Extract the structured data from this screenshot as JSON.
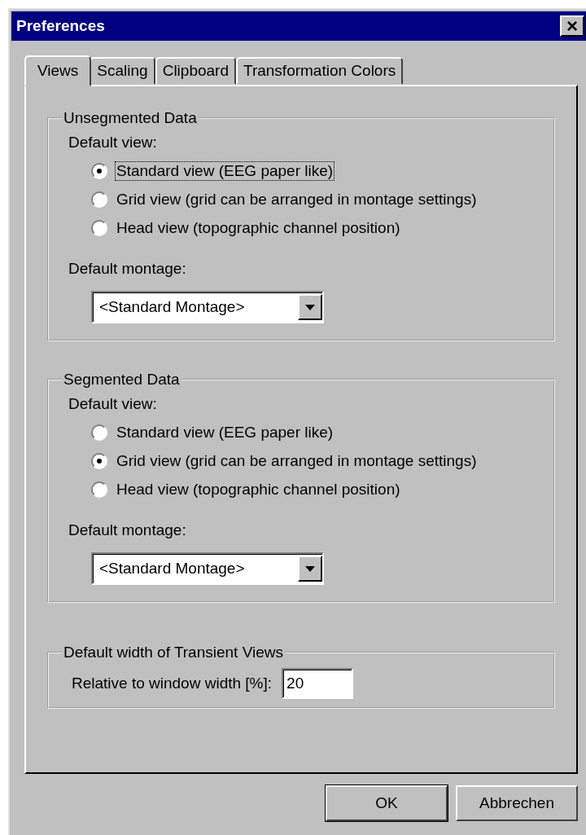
{
  "window": {
    "title": "Preferences",
    "close": "×"
  },
  "tabs": [
    {
      "label": "Views",
      "selected": true
    },
    {
      "label": "Scaling",
      "selected": false
    },
    {
      "label": "Clipboard",
      "selected": false
    },
    {
      "label": "Transformation Colors",
      "selected": false
    }
  ],
  "groups": [
    {
      "kind": "views",
      "title": "Unsegmented Data",
      "view_label": "Default view:",
      "options": [
        {
          "label": "Standard view (EEG paper like)",
          "selected": true,
          "focused": true
        },
        {
          "label": "Grid view (grid can be arranged in montage settings)",
          "selected": false,
          "focused": false
        },
        {
          "label": "Head view (topographic channel position)",
          "selected": false,
          "focused": false
        }
      ],
      "montage_label": "Default montage:",
      "montage_value": "<Standard Montage>"
    },
    {
      "kind": "views",
      "title": "Segmented Data",
      "view_label": "Default view:",
      "options": [
        {
          "label": "Standard view (EEG paper like)",
          "selected": false,
          "focused": false
        },
        {
          "label": "Grid view (grid can be arranged in montage settings)",
          "selected": true,
          "focused": false
        },
        {
          "label": "Head view (topographic channel position)",
          "selected": false,
          "focused": false
        }
      ],
      "montage_label": "Default montage:",
      "montage_value": "<Standard Montage>"
    },
    {
      "kind": "width",
      "title": "Default width of Transient Views",
      "field_label": "Relative to window width [%]:",
      "field_value": "20"
    }
  ],
  "buttons": [
    {
      "label": "OK",
      "default": true
    },
    {
      "label": "Abbrechen",
      "default": false
    }
  ]
}
